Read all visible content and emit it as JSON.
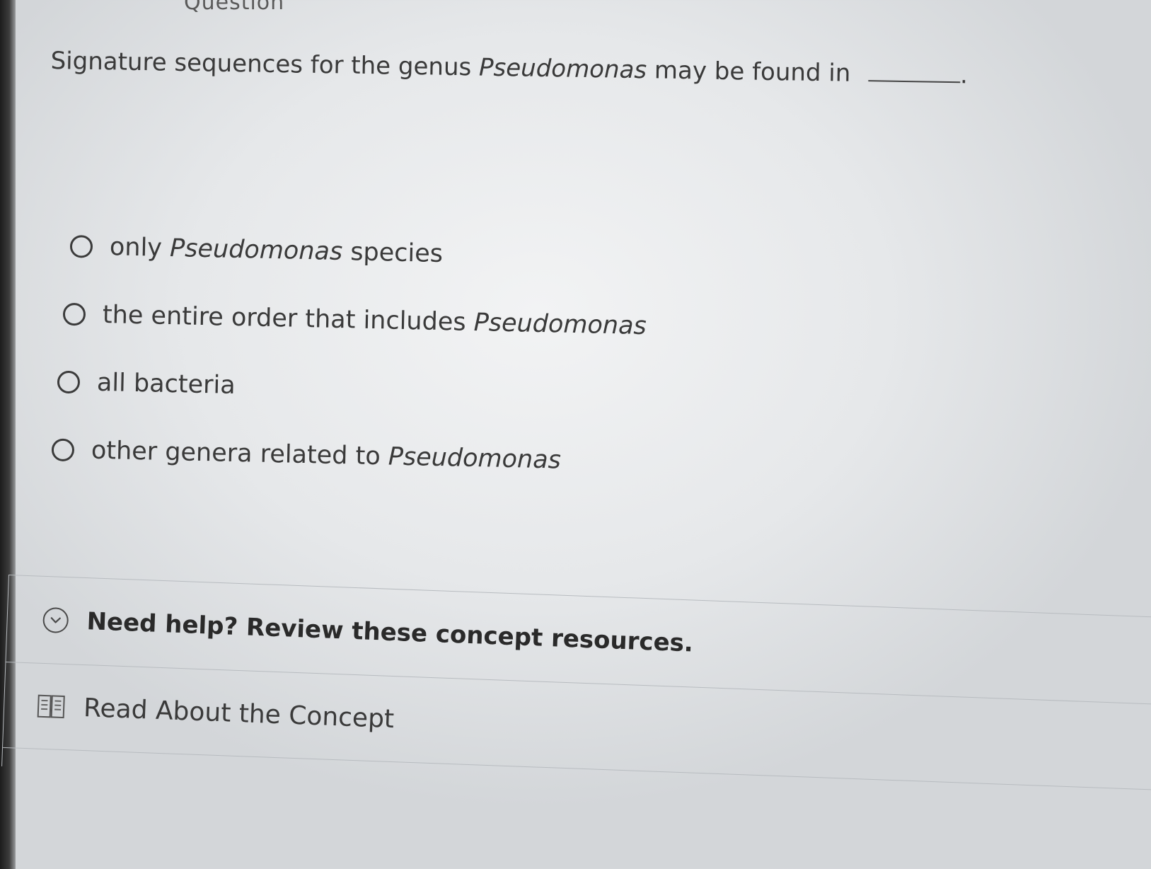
{
  "header": {
    "partial_heading": "Question"
  },
  "question": {
    "text_before": "Signature sequences for the genus",
    "genus": "Pseudomonas",
    "text_after": "may be found in",
    "ending": "."
  },
  "options": [
    {
      "before": "only",
      "genus": "Pseudomonas",
      "after": "species"
    },
    {
      "before": "the entire order that includes",
      "genus": "Pseudomonas",
      "after": ""
    },
    {
      "before": "all bacteria",
      "genus": "",
      "after": ""
    },
    {
      "before": "other genera related to",
      "genus": "Pseudomonas",
      "after": ""
    }
  ],
  "help": {
    "title": "Need help? Review these concept resources.",
    "icon": "chevron-down-circle-icon",
    "resources": [
      {
        "label": "Read About the Concept",
        "icon": "book-icon"
      }
    ]
  },
  "colors": {
    "text": "#3a3a3a",
    "divider": "#b8bcc0",
    "background": "#e9ebed"
  }
}
